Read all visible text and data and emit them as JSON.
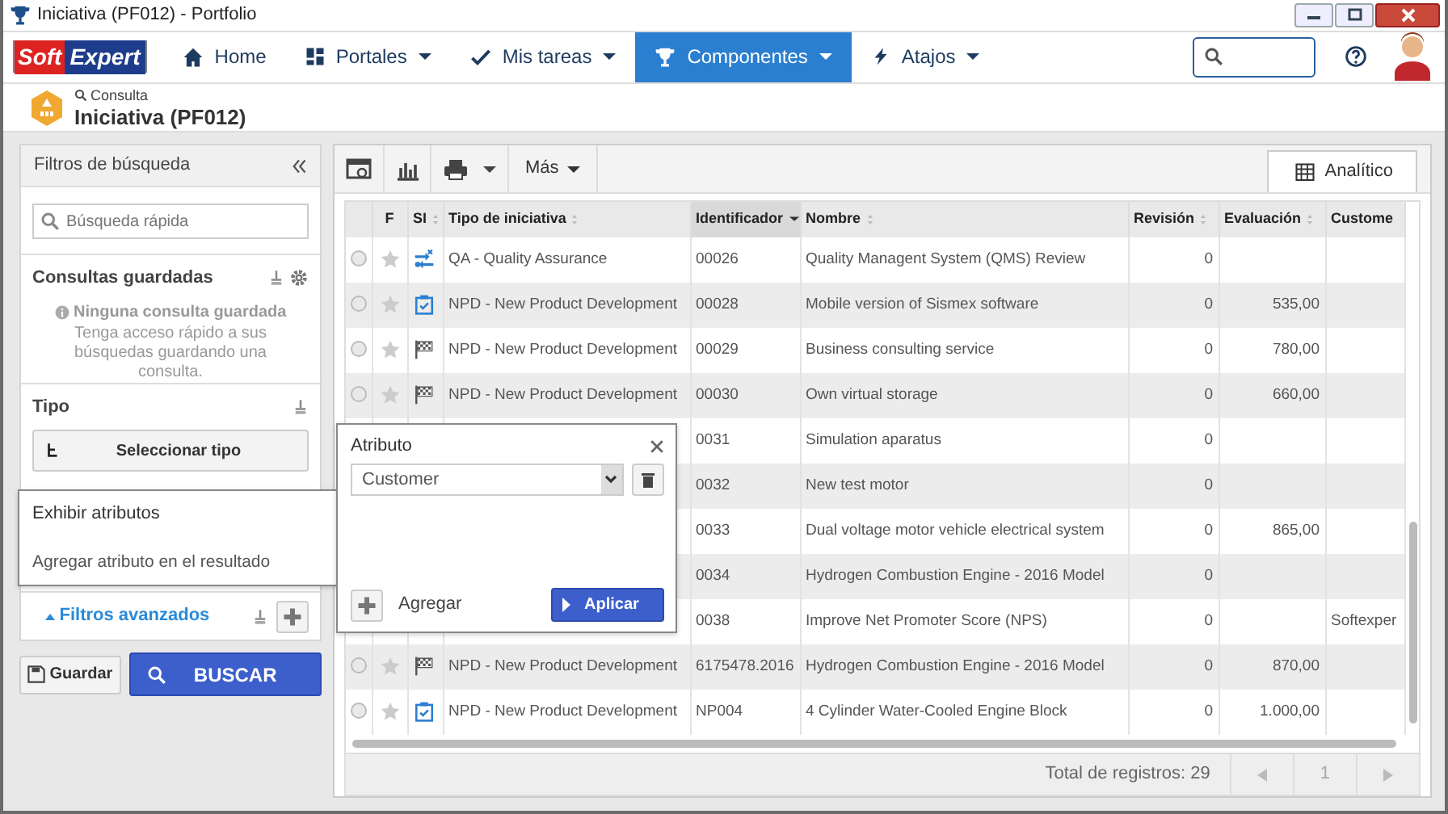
{
  "window": {
    "title": "Iniciativa (PF012) - Portfolio"
  },
  "navbar": {
    "logo": [
      "Soft",
      "Expert"
    ],
    "items": [
      {
        "label": "Home",
        "dropdown": false,
        "selected": false
      },
      {
        "label": "Portales",
        "dropdown": true,
        "selected": false
      },
      {
        "label": "Mis tareas",
        "dropdown": true,
        "selected": false
      },
      {
        "label": "Componentes",
        "dropdown": true,
        "selected": true
      },
      {
        "label": "Atajos",
        "dropdown": true,
        "selected": false
      }
    ]
  },
  "header": {
    "breadcrumb": "Consulta",
    "title": "Iniciativa (PF012)"
  },
  "filters": {
    "title": "Filtros de búsqueda",
    "search_placeholder": "Búsqueda rápida",
    "saved_title": "Consultas guardadas",
    "saved_empty": "Ninguna consulta guardada",
    "saved_hint": "Tenga acceso rápido a sus búsquedas guardando una consulta.",
    "type_title": "Tipo",
    "type_button": "Seleccionar tipo",
    "advanced": "Filtros avanzados",
    "advanced_expanded": true,
    "save": "Guardar",
    "search": "BUSCAR"
  },
  "toolbar": {
    "more": "Más",
    "tab": {
      "label": "Analítico",
      "selected": true
    }
  },
  "table": {
    "columns": [
      {
        "label": "F",
        "sortable": false,
        "sorted": false
      },
      {
        "label": "SI",
        "sortable": true,
        "sorted": false
      },
      {
        "label": "Tipo de iniciativa",
        "sortable": true,
        "sorted": false
      },
      {
        "label": "Identificador",
        "sortable": true,
        "sorted": true
      },
      {
        "label": "Nombre",
        "sortable": true,
        "sorted": false
      },
      {
        "label": "Revisión",
        "sortable": true,
        "sorted": false
      },
      {
        "label": "Evaluación",
        "sortable": true,
        "sorted": false
      },
      {
        "label": "Custome",
        "sortable": false,
        "sorted": false
      }
    ],
    "rows": [
      {
        "selected": false,
        "starred": false,
        "kind": "swap",
        "tipo": "QA - Quality Assurance",
        "id": "00026",
        "nombre": "Quality Managent System (QMS) Review",
        "revision": "0"
      },
      {
        "selected": false,
        "starred": false,
        "kind": "clipboard",
        "tipo": "NPD - New Product Development",
        "id": "00028",
        "nombre": "Mobile version of Sismex software",
        "revision": "0",
        "evaluacion": "535,00"
      },
      {
        "selected": false,
        "starred": false,
        "kind": "flag",
        "tipo": "NPD - New Product Development",
        "id": "00029",
        "nombre": "Business consulting service",
        "revision": "0",
        "evaluacion": "780,00"
      },
      {
        "selected": false,
        "starred": false,
        "kind": "flag",
        "tipo": "NPD - New Product Development",
        "id": "00030",
        "nombre": "Own virtual storage",
        "revision": "0",
        "evaluacion": "660,00"
      },
      {
        "id": "0031",
        "nombre": "Simulation aparatus",
        "revision": "0"
      },
      {
        "id": "0032",
        "nombre": "New test motor",
        "revision": "0"
      },
      {
        "id": "0033",
        "nombre": "Dual voltage motor vehicle electrical system",
        "revision": "0",
        "evaluacion": "865,00"
      },
      {
        "id": "0034",
        "nombre": "Hydrogen Combustion Engine - 2016 Model",
        "revision": "0"
      },
      {
        "id": "0038",
        "nombre": "Improve Net Promoter Score (NPS)",
        "revision": "0",
        "customer": "Softexper"
      },
      {
        "selected": false,
        "starred": false,
        "kind": "flag",
        "tipo": "NPD - New Product Development",
        "id": "6175478.2016",
        "nombre": "Hydrogen Combustion Engine - 2016 Model",
        "revision": "0",
        "evaluacion": "870,00"
      },
      {
        "selected": false,
        "starred": false,
        "kind": "clipboard",
        "tipo": "NPD - New Product Development",
        "id": "NP004",
        "nombre": "4 Cylinder Water-Cooled Engine Block",
        "revision": "0",
        "evaluacion": "1.000,00"
      }
    ]
  },
  "footer": {
    "total": "Total de registros: 29",
    "page": "1"
  },
  "display_attributes": {
    "title": "Exhibir atributos",
    "hint": "Agregar atributo en el resultado"
  },
  "attribute_popup": {
    "title": "Atributo",
    "value": "Customer",
    "add": "Agregar",
    "apply": "Aplicar"
  }
}
